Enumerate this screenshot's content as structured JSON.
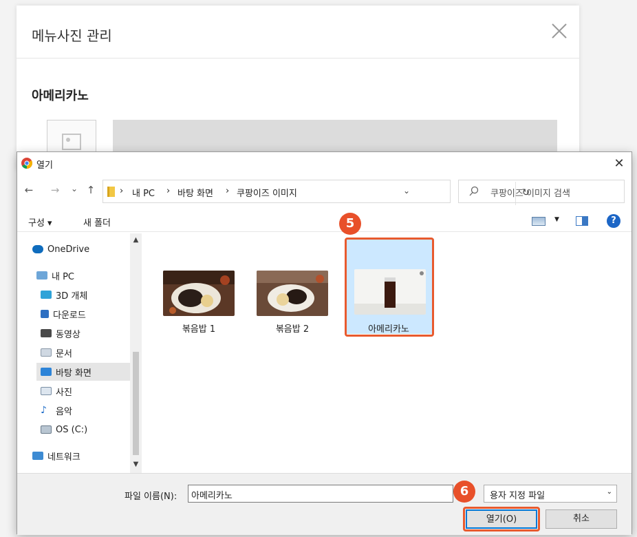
{
  "background_modal": {
    "title": "메뉴사진 관리",
    "item_name": "아메리카노"
  },
  "dialog": {
    "title": "열기",
    "nav": {
      "back": "←",
      "forward": "→",
      "recent": "⌄",
      "up": "↑"
    },
    "breadcrumb": [
      "내 PC",
      "바탕 화면",
      "쿠팡이즈 이미지"
    ],
    "search_placeholder": "쿠팡이즈 이미지 검색",
    "commands": {
      "organize": "구성 ▾",
      "new_folder": "새 폴더",
      "help": "?"
    },
    "sidebar": [
      {
        "label": "OneDrive",
        "icon": "cloud-icon"
      },
      {
        "label": "내 PC",
        "icon": "pc-icon"
      },
      {
        "label": "3D 개체",
        "icon": "cube-icon"
      },
      {
        "label": "다운로드",
        "icon": "download-icon"
      },
      {
        "label": "동영상",
        "icon": "video-icon"
      },
      {
        "label": "문서",
        "icon": "document-icon"
      },
      {
        "label": "바탕 화면",
        "icon": "desktop-icon",
        "selected": true
      },
      {
        "label": "사진",
        "icon": "picture-icon"
      },
      {
        "label": "음악",
        "icon": "music-icon"
      },
      {
        "label": "OS (C:)",
        "icon": "drive-icon"
      },
      {
        "label": "네트워크",
        "icon": "network-icon"
      }
    ],
    "files": [
      {
        "name": "볶음밥 1",
        "image": "fried-rice-plate"
      },
      {
        "name": "볶음밥 2",
        "image": "fried-rice-plate"
      },
      {
        "name": "아메리카노",
        "image": "iced-americano",
        "selected": true
      }
    ],
    "footer": {
      "filename_label": "파일 이름(N):",
      "filename_value": "아메리카노",
      "filter": "용자 지정 파일",
      "open_button": "열기(O)",
      "cancel_button": "취소"
    }
  },
  "annotations": {
    "step5": "5",
    "step6": "6"
  },
  "colors": {
    "accent": "#e8502a",
    "selection": "#cce8ff",
    "primary_border": "#0078d7"
  }
}
